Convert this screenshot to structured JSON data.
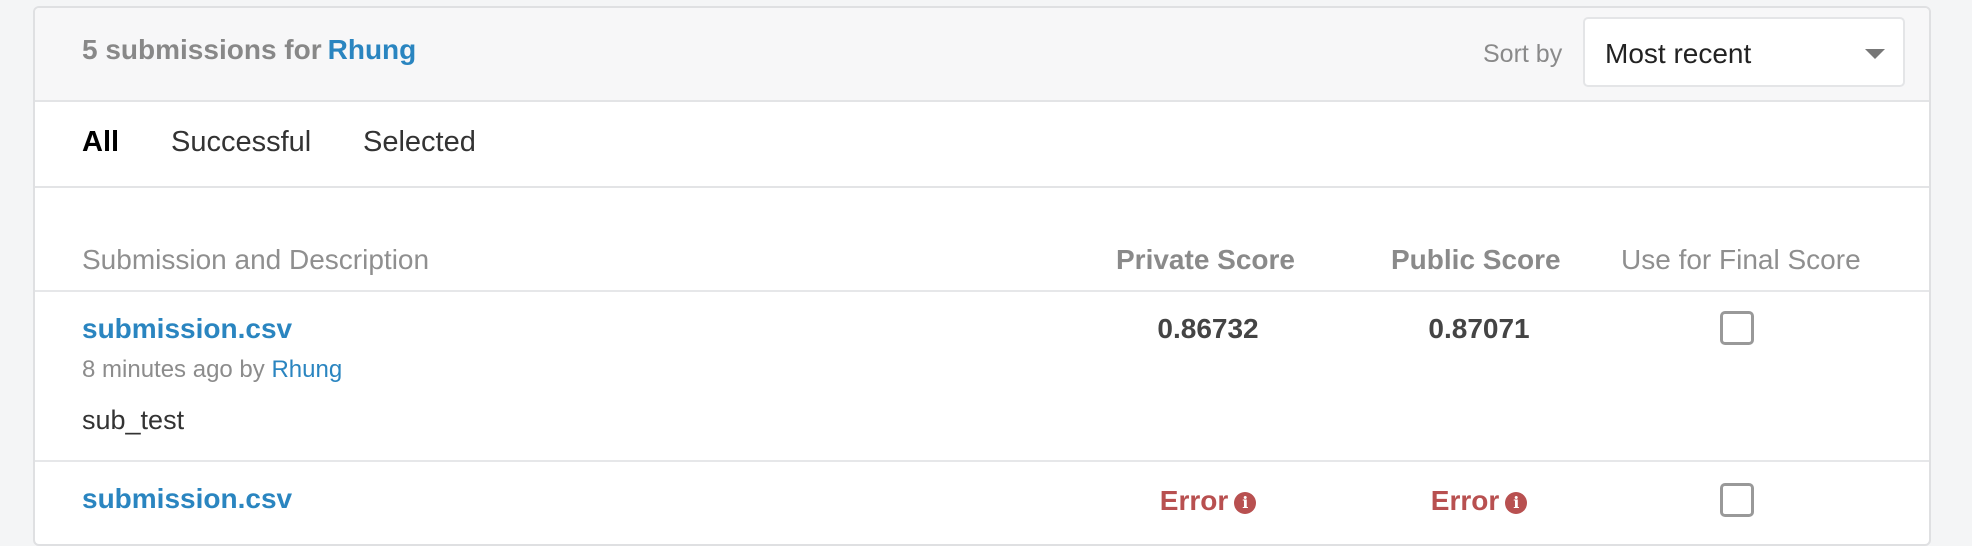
{
  "header": {
    "count_text": "5 submissions for",
    "user": "Rhung",
    "sort_label": "Sort by",
    "sort_value": "Most recent"
  },
  "tabs": [
    {
      "label": "All",
      "active": true
    },
    {
      "label": "Successful",
      "active": false
    },
    {
      "label": "Selected",
      "active": false
    }
  ],
  "columns": {
    "submission": "Submission and Description",
    "private": "Private Score",
    "public": "Public Score",
    "final": "Use for Final Score"
  },
  "rows": [
    {
      "filename": "submission.csv",
      "time": "8 minutes ago by",
      "user": "Rhung",
      "description": "sub_test",
      "private_score": "0.86732",
      "public_score": "0.87071",
      "selected": false
    },
    {
      "filename": "submission.csv",
      "private_score": "Error",
      "public_score": "Error",
      "selected": false
    }
  ],
  "icons": {
    "info": "info-icon",
    "dropdown": "chevron-down-icon"
  },
  "colors": {
    "link": "#2a85c0",
    "error": "#b85050"
  }
}
